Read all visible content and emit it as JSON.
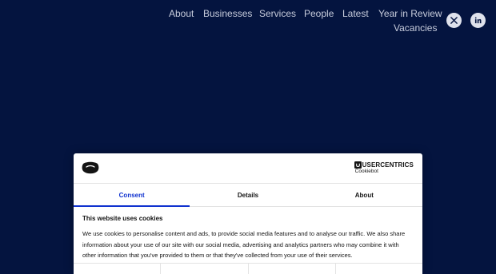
{
  "nav": {
    "links": [
      {
        "label": "About"
      },
      {
        "label": "Businesses"
      },
      {
        "label": "Services"
      },
      {
        "label": "People"
      },
      {
        "label": "Latest"
      },
      {
        "label": "Year in Review"
      },
      {
        "label": "Vacancies"
      }
    ],
    "social": [
      {
        "icon": "x-twitter-icon"
      },
      {
        "icon": "linkedin-icon"
      }
    ]
  },
  "cookie_dialog": {
    "brand": {
      "name": "USERCENTRICS",
      "product": "Cookiebot"
    },
    "tabs": [
      {
        "label": "Consent",
        "active": true
      },
      {
        "label": "Details",
        "active": false
      },
      {
        "label": "About",
        "active": false
      }
    ],
    "heading": "This website uses cookies",
    "body": "We use cookies to personalise content and ads, to provide social media features and to analyse our traffic. We also share information about your use of our site with our social media, advertising and analytics partners who may combine it with other information that you've provided to them or that they've collected from your use of their services."
  },
  "colors": {
    "background": "#04143f",
    "accent": "#1032cf",
    "nav_text": "#c7ccdc"
  }
}
